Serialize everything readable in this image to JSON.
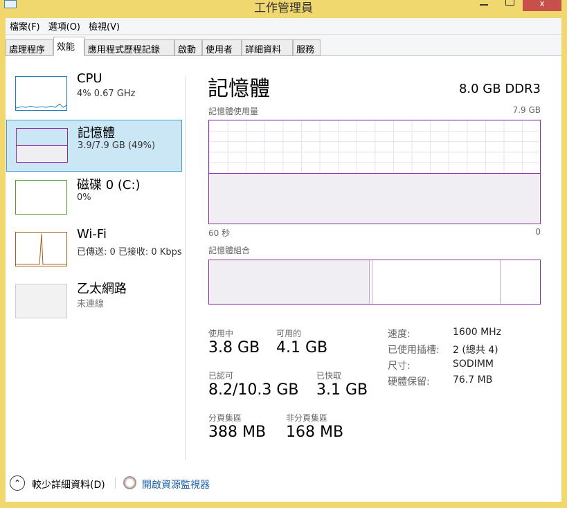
{
  "window": {
    "title": "工作管理員"
  },
  "menu": [
    "檔案(F)",
    "選項(O)",
    "檢視(V)"
  ],
  "tabs": [
    "處理程序",
    "效能",
    "應用程式歷程記錄",
    "啟動",
    "使用者",
    "詳細資料",
    "服務"
  ],
  "sidebar": [
    {
      "name": "CPU",
      "sub": "4% 0.67 GHz",
      "color": "#1b79b3"
    },
    {
      "name": "記憶體",
      "sub": "3.9/7.9 GB (49%)",
      "color": "#8b2aa3"
    },
    {
      "name": "磁碟 0 (C:)",
      "sub": "0%",
      "color": "#4da028"
    },
    {
      "name": "Wi-Fi",
      "sub": "已傳送: 0 已接收: 0 Kbps",
      "color": "#a75f1c"
    },
    {
      "name": "乙太網路",
      "sub": "未連線",
      "color": "#bbbbbb"
    }
  ],
  "main": {
    "title": "記憶體",
    "spec": "8.0 GB DDR3",
    "usage_label": "記憶體使用量",
    "usage_max": "7.9 GB",
    "time_left": "60 秒",
    "time_right": "0",
    "usage_fraction": 0.49,
    "composition_label": "記憶體組合",
    "stats": {
      "in_use_label": "使用中",
      "in_use": "3.8 GB",
      "available_label": "可用的",
      "available": "4.1 GB",
      "committed_label": "已認可",
      "committed": "8.2/10.3 GB",
      "cached_label": "已快取",
      "cached": "3.1 GB",
      "paged_label": "分頁集區",
      "paged": "388 MB",
      "nonpaged_label": "非分頁集區",
      "nonpaged": "168 MB"
    },
    "props": [
      {
        "k": "速度:",
        "v": "1600 MHz"
      },
      {
        "k": "已使用插槽:",
        "v": "2 (總共 4)"
      },
      {
        "k": "尺寸:",
        "v": "SODIMM"
      },
      {
        "k": "硬體保留:",
        "v": "76.7 MB"
      }
    ]
  },
  "footer": {
    "fewer_details": "較少詳細資料(D)",
    "open_monitor": "開啟資源監視器"
  }
}
